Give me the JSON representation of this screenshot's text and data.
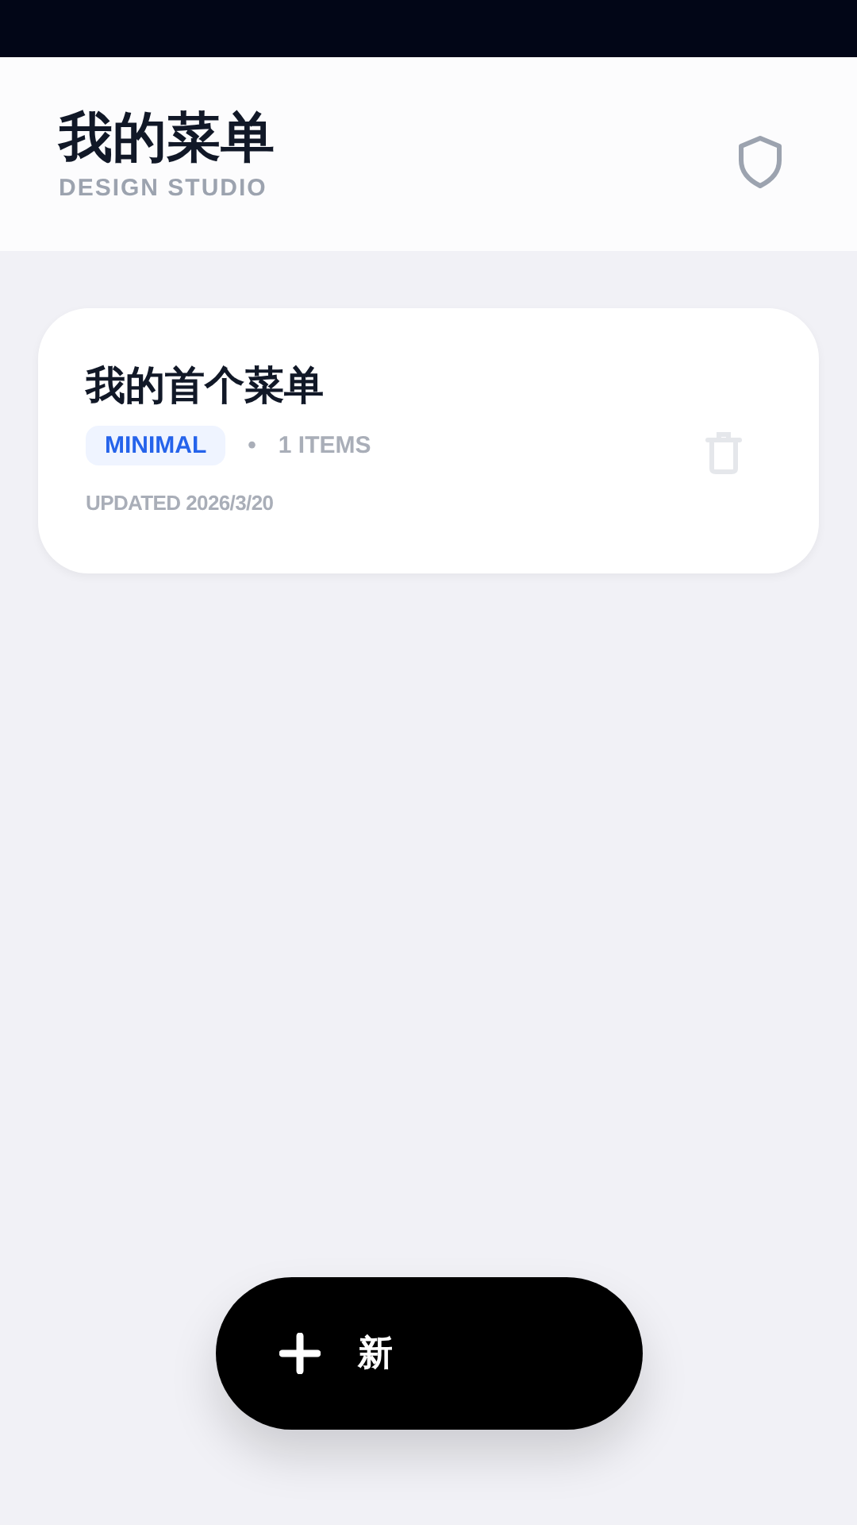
{
  "header": {
    "title": "我的菜单",
    "subtitle": "DESIGN STUDIO"
  },
  "menus": [
    {
      "name": "我的首个菜单",
      "tag": "MINIMAL",
      "count": "1 ITEMS",
      "separator": "•",
      "updated": "UPDATED 2026/3/20"
    }
  ],
  "new_button": {
    "label": "新"
  }
}
